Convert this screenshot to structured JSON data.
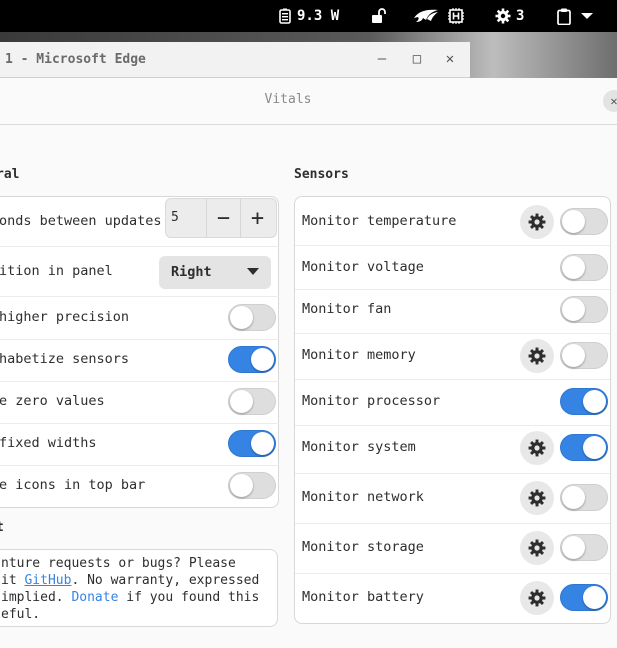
{
  "topbar": {
    "power_value": "9.3 W",
    "notification_count": "3",
    "icons": [
      "battery-icon",
      "unlock-icon",
      "rog-logo-icon",
      "chip-icon",
      "gear-icon",
      "clipboard-icon",
      "chevron-down-icon"
    ]
  },
  "edge_window": {
    "title": "1 - Microsoft Edge",
    "minimize": "–",
    "maximize": "□",
    "close": "✕"
  },
  "dialog": {
    "title": "Vitals",
    "close": "✕"
  },
  "general": {
    "title": "ral",
    "update_label": "onds between updates",
    "update_value": "5",
    "decrement": "−",
    "increment": "+",
    "position_label": "ition in panel",
    "position_value": "Right",
    "rows": [
      {
        "label": " higher precision",
        "on": false
      },
      {
        "label": "habetize sensors",
        "on": true
      },
      {
        "label": "e zero values",
        "on": false
      },
      {
        "label": " fixed widths",
        "on": true
      },
      {
        "label": "e icons in top bar",
        "on": false
      }
    ]
  },
  "about": {
    "title": "t",
    "line1": "nture requests or bugs? Please",
    "line2_a": "it ",
    "github": "GitHub",
    "line2_b": ". No warranty, expressed",
    "line3_a": " implied. ",
    "donate": "Donate",
    "line3_b": " if you found this",
    "line4": "eful."
  },
  "sensors": {
    "title": "Sensors",
    "items": [
      {
        "label": "Monitor temperature",
        "gear": true,
        "on": false
      },
      {
        "label": "Monitor voltage",
        "gear": false,
        "on": false
      },
      {
        "label": "Monitor fan",
        "gear": false,
        "on": false
      },
      {
        "label": "Monitor memory",
        "gear": true,
        "on": false
      },
      {
        "label": "Monitor processor",
        "gear": false,
        "on": true
      },
      {
        "label": "Monitor system",
        "gear": true,
        "on": true
      },
      {
        "label": "Monitor network",
        "gear": true,
        "on": false
      },
      {
        "label": "Monitor storage",
        "gear": true,
        "on": false
      },
      {
        "label": "Monitor battery",
        "gear": true,
        "on": true
      }
    ]
  },
  "colors": {
    "accent": "#3584e4",
    "toggle_off": "#dedede",
    "topbar": "#000000"
  }
}
